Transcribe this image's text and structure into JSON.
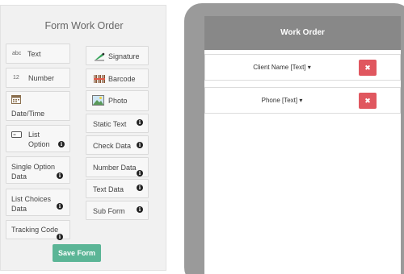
{
  "panel": {
    "title": "Form Work Order",
    "items": {
      "text": "Text",
      "text_icon": "abc",
      "number": "Number",
      "number_icon": "12",
      "datetime": "Date/Time",
      "list_option_1": "List",
      "list_option_2": "Option",
      "single_option_1": "Single Option",
      "single_option_2": "Data",
      "list_choices_1": "List Choices",
      "list_choices_2": "Data",
      "tracking_code": "Tracking Code",
      "signature": "Signature",
      "barcode": "Barcode",
      "photo": "Photo",
      "static_text": "Static Text",
      "check_data": "Check Data",
      "number_data": "Number Data",
      "text_data": "Text Data",
      "sub_form": "Sub Form"
    },
    "info_glyph": "i",
    "save_label": "Save Form"
  },
  "preview": {
    "header": "Work Order",
    "fields": [
      {
        "label": "Client Name [Text] ▾",
        "delete": "✖"
      },
      {
        "label": "Phone [Text] ▾",
        "delete": "✖"
      }
    ]
  },
  "colors": {
    "save_button": "#5bb596",
    "delete_button": "#e0575f",
    "header": "#888888",
    "phone_frame": "#9a9a9a"
  }
}
